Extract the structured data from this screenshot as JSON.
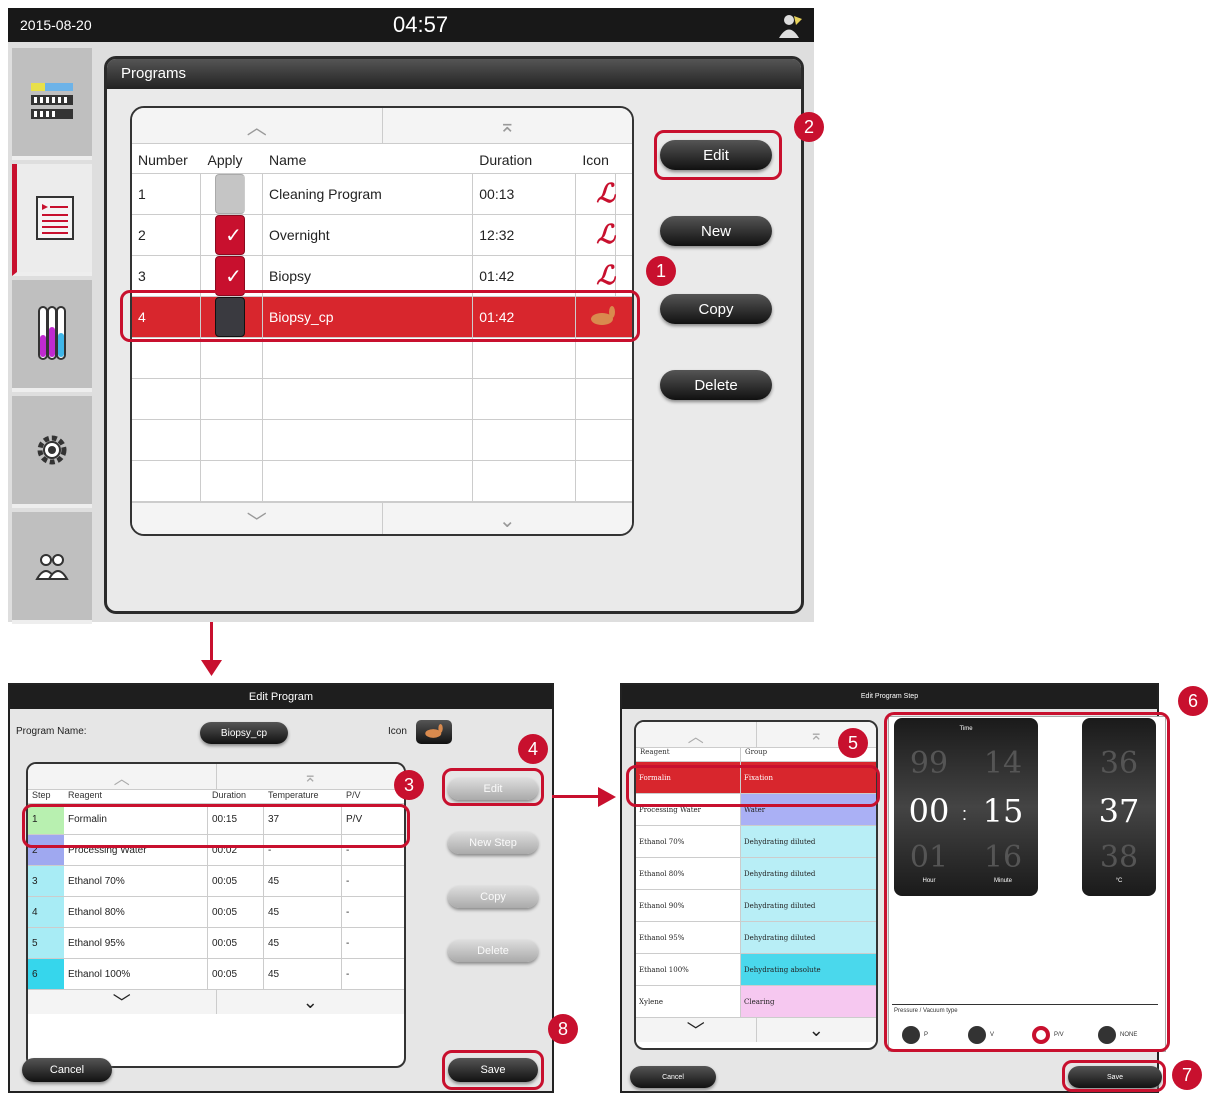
{
  "main": {
    "date": "2015-08-20",
    "time": "04:57",
    "panel_title": "Programs",
    "columns": [
      "Number",
      "Apply",
      "Name",
      "Duration",
      "Icon"
    ],
    "rows": [
      {
        "number": "1",
        "name": "Cleaning Program",
        "duration": "00:13"
      },
      {
        "number": "2",
        "name": "Overnight",
        "duration": "12:32"
      },
      {
        "number": "3",
        "name": "Biopsy",
        "duration": "01:42"
      },
      {
        "number": "4",
        "name": "Biopsy_cp",
        "duration": "01:42"
      }
    ],
    "buttons": {
      "edit": "Edit",
      "new": "New",
      "copy": "Copy",
      "delete": "Delete"
    }
  },
  "edit_program": {
    "title": "Edit Program",
    "program_name_label": "Program Name:",
    "program_name": "Biopsy_cp",
    "icon_label": "Icon",
    "columns": [
      "Step",
      "Reagent",
      "Duration",
      "Temperature",
      "P/V"
    ],
    "steps": [
      {
        "step": "1",
        "reagent": "Formalin",
        "duration": "00:15",
        "temp": "37",
        "pv": "P/V",
        "color": "#b8f0b0"
      },
      {
        "step": "2",
        "reagent": "Processing Water",
        "duration": "00:02",
        "temp": "-",
        "pv": "-",
        "color": "#9fa8f0"
      },
      {
        "step": "3",
        "reagent": "Ethanol 70%",
        "duration": "00:05",
        "temp": "45",
        "pv": "-",
        "color": "#a8ecf5"
      },
      {
        "step": "4",
        "reagent": "Ethanol 80%",
        "duration": "00:05",
        "temp": "45",
        "pv": "-",
        "color": "#a8ecf5"
      },
      {
        "step": "5",
        "reagent": "Ethanol 95%",
        "duration": "00:05",
        "temp": "45",
        "pv": "-",
        "color": "#a8ecf5"
      },
      {
        "step": "6",
        "reagent": "Ethanol 100%",
        "duration": "00:05",
        "temp": "45",
        "pv": "-",
        "color": "#36d6ec"
      }
    ],
    "buttons": {
      "edit": "Edit",
      "new_step": "New Step",
      "copy": "Copy",
      "delete": "Delete",
      "save": "Save",
      "cancel": "Cancel"
    }
  },
  "edit_step": {
    "title": "Edit Program Step",
    "columns": [
      "Reagent",
      "Group"
    ],
    "reagents": [
      {
        "reagent": "Formalin",
        "group": "Fixation",
        "color": "#d8262d"
      },
      {
        "reagent": "Processing Water",
        "group": "Water",
        "color": "#aab0f5"
      },
      {
        "reagent": "Ethanol 70%",
        "group": "Dehydrating diluted",
        "color": "#b8eef6"
      },
      {
        "reagent": "Ethanol 80%",
        "group": "Dehydrating diluted",
        "color": "#b8eef6"
      },
      {
        "reagent": "Ethanol 90%",
        "group": "Dehydrating diluted",
        "color": "#b8eef6"
      },
      {
        "reagent": "Ethanol 95%",
        "group": "Dehydrating diluted",
        "color": "#b8eef6"
      },
      {
        "reagent": "Ethanol 100%",
        "group": "Dehydrating absolute",
        "color": "#4ad8ec"
      },
      {
        "reagent": "Xylene",
        "group": "Clearing",
        "color": "#f6c8f0"
      }
    ],
    "time_label": "Time",
    "hour": {
      "prev": "99",
      "value": "00",
      "next": "01",
      "label": "Hour"
    },
    "minute": {
      "prev": "14",
      "value": "15",
      "next": "16",
      "label": "Minute"
    },
    "temp": {
      "prev": "36",
      "value": "37",
      "next": "38",
      "label": "°C"
    },
    "pv_label": "Pressure / Vacuum type",
    "pv_options": [
      "P",
      "V",
      "P/V",
      "NONE"
    ],
    "pv_selected": "P/V",
    "buttons": {
      "save": "Save",
      "cancel": "Cancel"
    }
  },
  "callouts": [
    "1",
    "2",
    "3",
    "4",
    "5",
    "6",
    "7",
    "8"
  ]
}
